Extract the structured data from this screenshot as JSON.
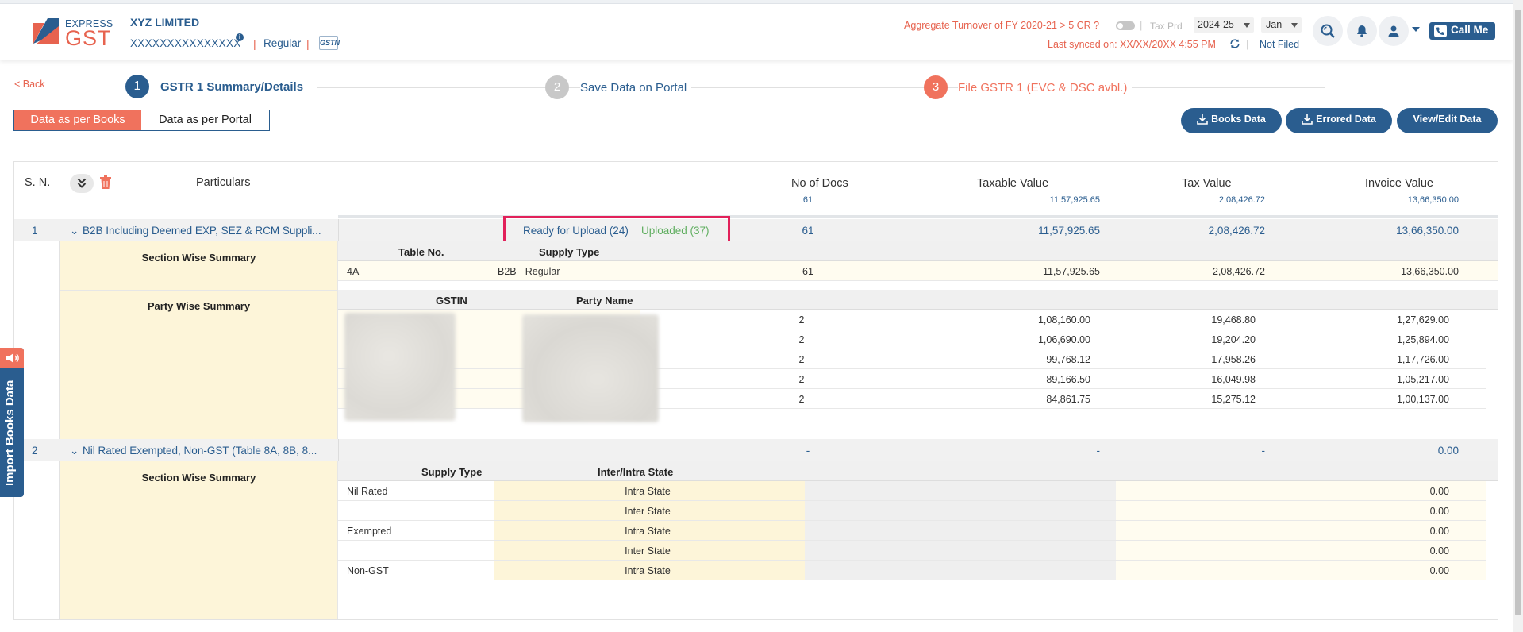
{
  "header": {
    "logo": {
      "express": "EXPRESS",
      "gst": "GST"
    },
    "company_name": "XYZ LIMITED",
    "gstin": "XXXXXXXXXXXXXXX",
    "info_badge": "i",
    "separator": "|",
    "taxpayer_type": "Regular",
    "gstn_logo_text": "GSTN",
    "turnover_question": "Aggregate Turnover of FY 2020-21 > 5 CR ?",
    "tax_period_label": "Tax Prd",
    "year": "2024-25",
    "month": "Jan",
    "last_synced": "Last synced on: XX/XX/20XX 4:55 PM",
    "filing_status": "Not Filed",
    "call_me": "Call Me"
  },
  "steps": {
    "back": "< Back",
    "items": [
      {
        "number": "1",
        "label": "GSTR 1 Summary/Details"
      },
      {
        "number": "2",
        "label": "Save Data on Portal"
      },
      {
        "number": "3",
        "label": "File GSTR 1 (EVC & DSC avbl.)"
      }
    ]
  },
  "view_toggle": {
    "books": "Data as per Books",
    "portal": "Data as per Portal",
    "active": "books"
  },
  "actions": {
    "books_data": "Books Data",
    "errored_data": "Errored Data",
    "view_edit": "View/Edit Data"
  },
  "table": {
    "columns": {
      "sn": "S. N.",
      "particulars": "Particulars",
      "docs": "No of Docs",
      "taxable": "Taxable Value",
      "tax": "Tax Value",
      "invoice": "Invoice Value"
    },
    "totals": {
      "docs": "61",
      "taxable": "11,57,925.65",
      "tax": "2,08,426.72",
      "invoice": "13,66,350.00"
    },
    "sections": [
      {
        "sn": "1",
        "title": "B2B Including Deemed EXP, SEZ & RCM Suppli...",
        "ready": "Ready for Upload (24)",
        "uploaded": "Uploaded (37)",
        "docs": "61",
        "taxable": "11,57,925.65",
        "tax": "2,08,426.72",
        "invoice": "13,66,350.00",
        "section_wise_label": "Section Wise Summary",
        "section_cols": {
          "table_no": "Table No.",
          "supply_type": "Supply Type"
        },
        "section_rows": [
          {
            "table_no": "4A",
            "supply_type": "B2B - Regular",
            "docs": "61",
            "taxable": "11,57,925.65",
            "tax": "2,08,426.72",
            "invoice": "13,66,350.00"
          }
        ],
        "party_wise_label": "Party Wise Summary",
        "party_cols": {
          "gstin": "GSTIN",
          "party_name": "Party Name"
        },
        "party_rows": [
          {
            "docs": "2",
            "taxable": "1,08,160.00",
            "tax": "19,468.80",
            "invoice": "1,27,629.00"
          },
          {
            "docs": "2",
            "taxable": "1,06,690.00",
            "tax": "19,204.20",
            "invoice": "1,25,894.00"
          },
          {
            "docs": "2",
            "taxable": "99,768.12",
            "tax": "17,958.26",
            "invoice": "1,17,726.00"
          },
          {
            "docs": "2",
            "taxable": "89,166.50",
            "tax": "16,049.98",
            "invoice": "1,05,217.00"
          },
          {
            "docs": "2",
            "taxable": "84,861.75",
            "tax": "15,275.12",
            "invoice": "1,00,137.00"
          }
        ]
      },
      {
        "sn": "2",
        "title": "Nil Rated Exempted, Non-GST (Table 8A, 8B, 8...",
        "docs": "-",
        "taxable": "-",
        "tax": "-",
        "invoice": "0.00",
        "section_wise_label": "Section Wise Summary",
        "nil_cols": {
          "supply_type": "Supply Type",
          "inter_intra": "Inter/Intra State"
        },
        "nil_rows": [
          {
            "supply_type": "Nil Rated",
            "state": "Intra State",
            "invoice": "0.00"
          },
          {
            "supply_type": "",
            "state": "Inter State",
            "invoice": "0.00"
          },
          {
            "supply_type": "Exempted",
            "state": "Intra State",
            "invoice": "0.00"
          },
          {
            "supply_type": "",
            "state": "Inter State",
            "invoice": "0.00"
          },
          {
            "supply_type": "Non-GST",
            "state": "Intra State",
            "invoice": "0.00"
          }
        ]
      }
    ]
  },
  "side_tab": {
    "label": "Import Books Data"
  },
  "colors": {
    "primary": "#2a5d8f",
    "accent": "#f0725d",
    "highlight_border": "#e2215a",
    "uploaded_green": "#5fae5f",
    "cream": "#fdf5d9"
  },
  "icons": [
    "express-gst-logo-mark",
    "info-icon",
    "search-icon",
    "bell-icon",
    "user-icon",
    "phone-icon",
    "sync-icon",
    "download-icon",
    "double-chevron-down-icon",
    "trash-icon",
    "chevron-down-icon",
    "megaphone-icon"
  ]
}
